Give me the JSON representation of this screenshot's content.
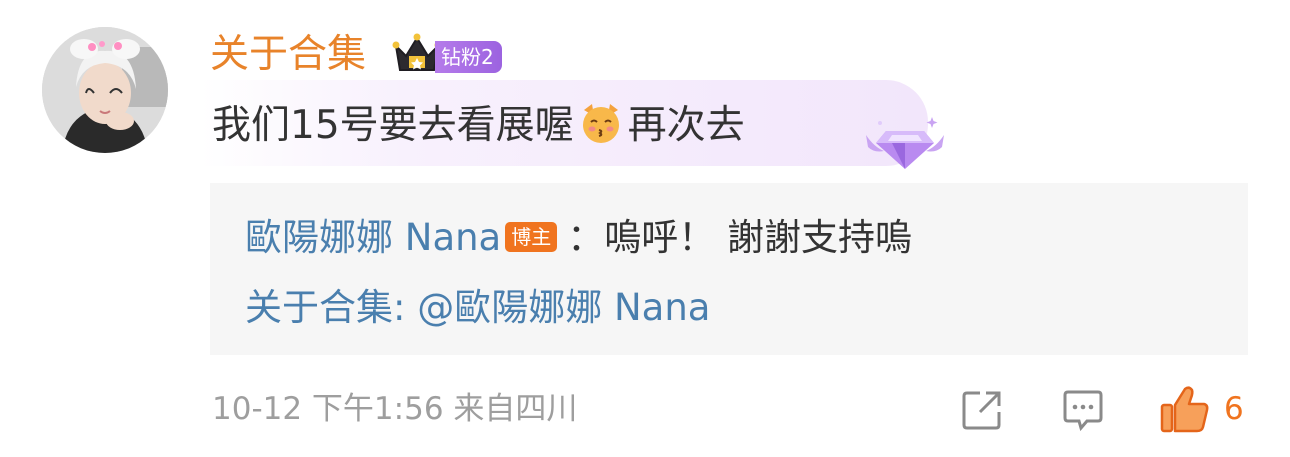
{
  "post": {
    "username": "关于合集",
    "fan_badge": "钻粉2",
    "comment_before_emoji": "我们15号要去看展喔",
    "comment_after_emoji": "再次去"
  },
  "reply": {
    "author": "歐陽娜娜 Nana",
    "author_badge": "博主",
    "text": "：嗚呼！ 謝謝支持嗚",
    "second_user": "关于合集",
    "second_text": ": @歐陽娜娜 Nana"
  },
  "meta": {
    "timestamp": "10-12 下午1:56 来自四川",
    "like_count": "6"
  },
  "icons": {
    "crown": "crown-icon",
    "emoji": "kissing-cat-emoji-icon",
    "gem": "diamond-gem-icon",
    "share": "share-icon",
    "comment": "comment-icon",
    "like": "thumbs-up-icon"
  },
  "colors": {
    "username": "#e8832a",
    "link": "#4a7fae",
    "accent": "#f0741f",
    "badge_purple": "#a86be6"
  }
}
